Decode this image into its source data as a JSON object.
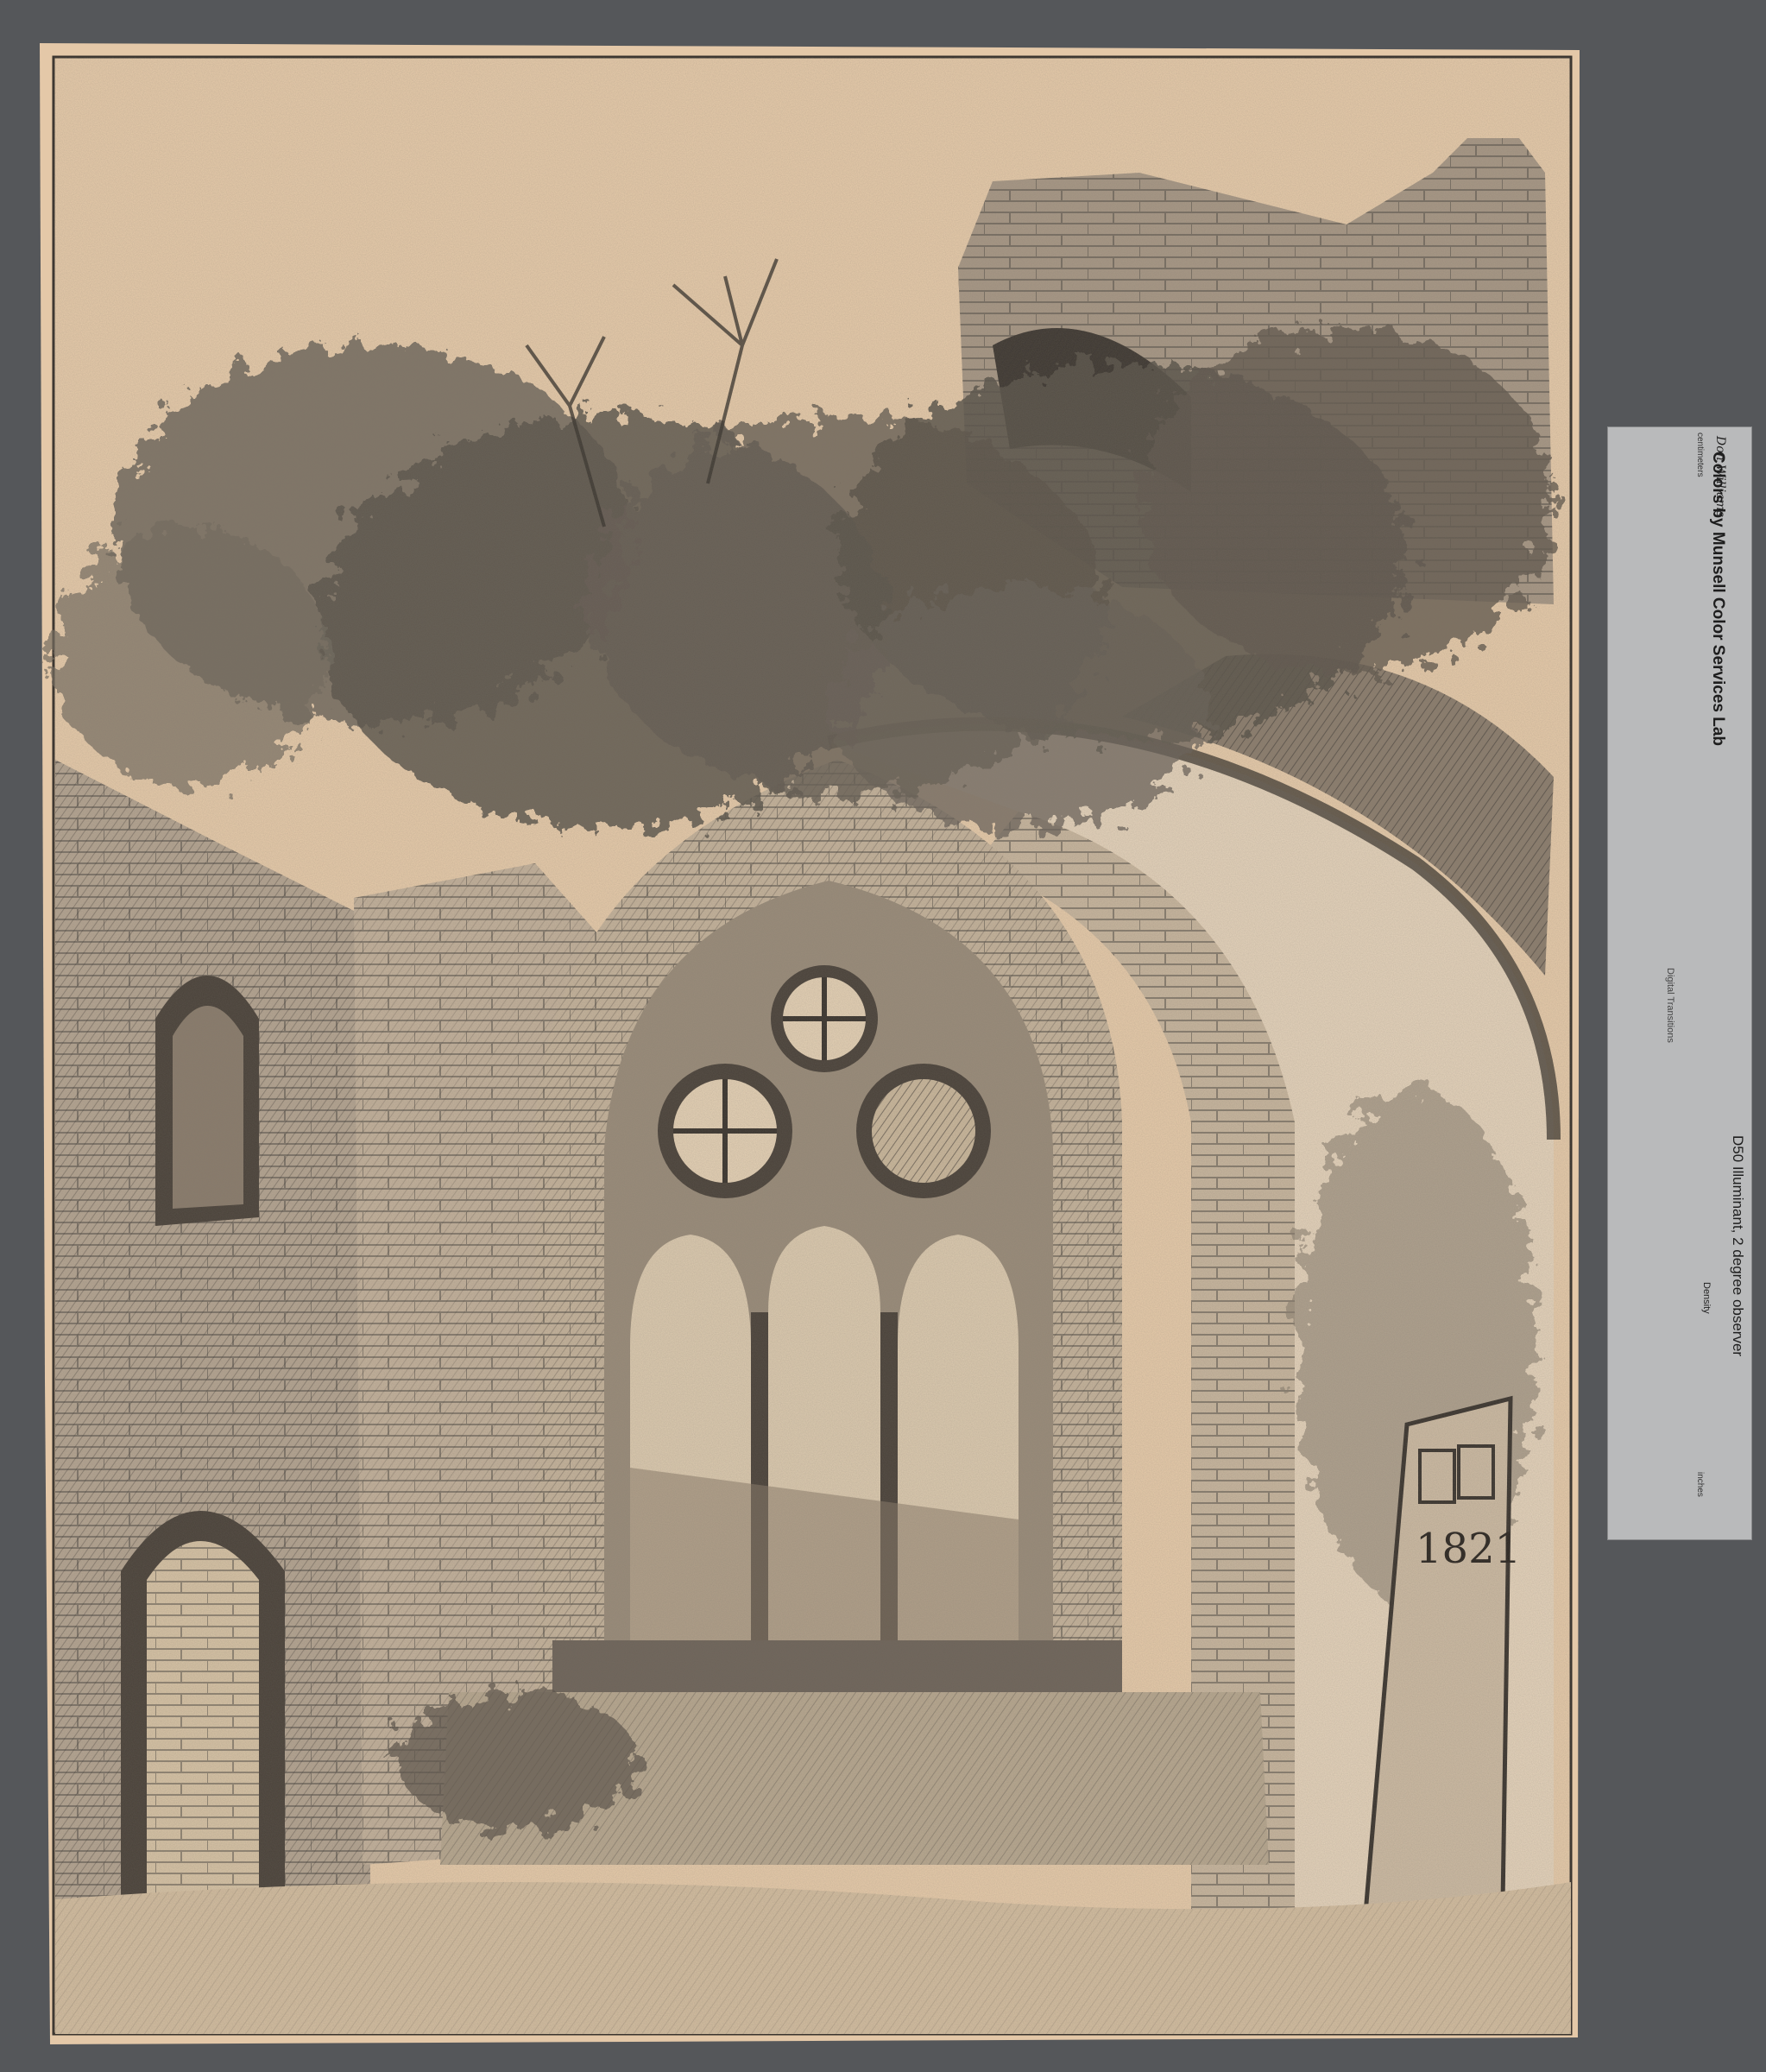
{
  "artwork": {
    "inscription_lines": [
      "1821"
    ]
  },
  "color_target": {
    "title": "Colors by Munsell Color Services Lab",
    "illuminant": "D50 Illuminant, 2 degree observer",
    "unit_top": "centimeters",
    "unit_bottom": "inches",
    "density_label": "Density",
    "brand": "Digital Transitions",
    "signature": "Don Williams",
    "swatch_colors": [
      "#3aa8c8",
      "#b44ea0",
      "#f0d21e",
      "#b82a3a",
      "#3b9a4a",
      "#3a4ea8",
      "#e8a01e",
      "#a4c43a",
      "#6a3a8a",
      "#141414",
      "#2a2a2a",
      "#273a34",
      "#3a3a3a",
      "#5a5a5a",
      "#7c7c7c"
    ],
    "gray_patches": [
      "#9a9a9a",
      "#b0b0b0",
      "#c2c2c2",
      "#d4d4d4",
      "#e2e2e2",
      "#f0f0f0"
    ],
    "bottom_colors": [
      "#d84a6a",
      "#4a6ec4",
      "#e87a28",
      "#4ac8b8",
      "#8a7ec8",
      "#5a7a3a",
      "#6a9ac8",
      "#d8908a",
      "#8a4a2a"
    ]
  }
}
